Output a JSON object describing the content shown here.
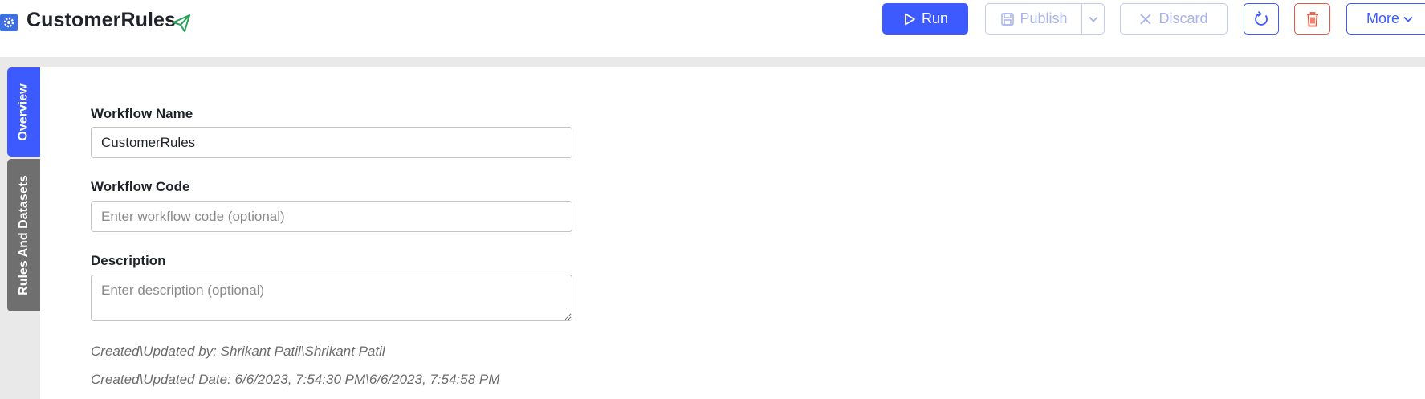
{
  "header": {
    "title": "CustomerRules",
    "app_icon": "gear-icon",
    "title_icon": "send-icon",
    "buttons": {
      "run": "Run",
      "publish": "Publish",
      "discard": "Discard",
      "more": "More"
    }
  },
  "tabs": [
    {
      "label": "Overview",
      "active": true
    },
    {
      "label": "Rules And Datasets",
      "active": false
    }
  ],
  "form": {
    "workflow_name": {
      "label": "Workflow Name",
      "value": "CustomerRules"
    },
    "workflow_code": {
      "label": "Workflow Code",
      "value": "",
      "placeholder": "Enter workflow code (optional)"
    },
    "description": {
      "label": "Description",
      "value": "",
      "placeholder": "Enter description (optional)"
    }
  },
  "meta": {
    "created_updated_by": "Created\\Updated by: Shrikant Patil\\Shrikant Patil",
    "created_updated_date": "Created\\Updated Date: 6/6/2023, 7:54:30 PM\\6/6/2023, 7:54:58 PM"
  },
  "colors": {
    "accent": "#3d5afe",
    "danger": "#e05a44",
    "tab_inactive": "#6f6f6f",
    "send_icon": "#2aa05a"
  }
}
